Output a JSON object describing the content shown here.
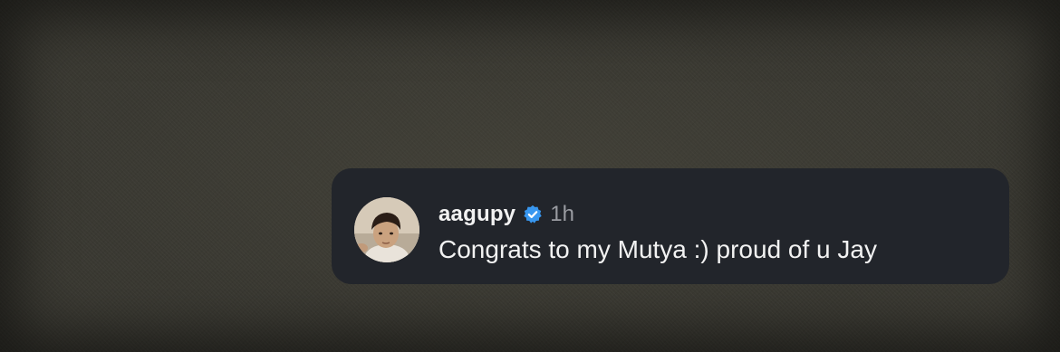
{
  "comment": {
    "username": "aagupy",
    "verified": true,
    "verified_icon": "verified-badge-icon",
    "timestamp": "1h",
    "text": "Congrats to my Mutya :) proud of u Jay",
    "avatar_icon": "profile-photo"
  },
  "colors": {
    "card_background": "#22252b",
    "username": "#f2f2f2",
    "timestamp": "#9a9ca2",
    "verified_badge": "#3897f0",
    "page_background": "#3a3932"
  }
}
